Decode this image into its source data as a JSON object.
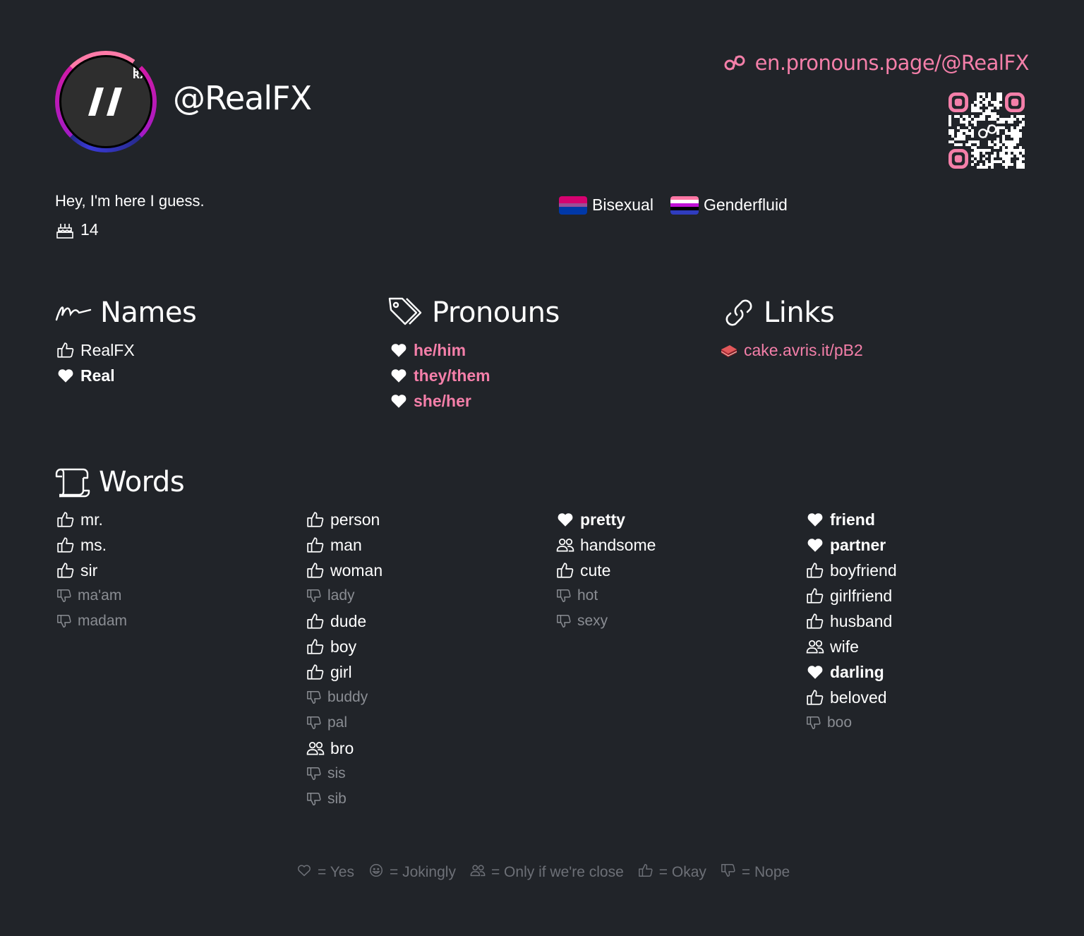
{
  "profile": {
    "avatar_text": [
      "RX",
      "RX-",
      "RX-/"
    ],
    "username": "@RealFX",
    "page_url": "en.pronouns.page/@RealFX",
    "bio": "Hey, I'm here I guess.",
    "age": "14"
  },
  "flags": [
    {
      "label": "Bisexual",
      "colors": [
        "#d60270",
        "#d60270",
        "#9b4f96",
        "#0038a8",
        "#0038a8"
      ]
    },
    {
      "label": "Genderfluid",
      "colors": [
        "#ff76a4",
        "#ffffff",
        "#c011d7",
        "#000000",
        "#2f3cbe"
      ]
    }
  ],
  "sections": {
    "names": {
      "title": "Names",
      "items": [
        {
          "label": "RealFX",
          "opinion": "okay"
        },
        {
          "label": "Real",
          "opinion": "yes"
        }
      ]
    },
    "pronouns": {
      "title": "Pronouns",
      "items": [
        {
          "label": "he/him",
          "opinion": "yes"
        },
        {
          "label": "they/them",
          "opinion": "yes"
        },
        {
          "label": "she/her",
          "opinion": "yes"
        }
      ]
    },
    "links": {
      "title": "Links",
      "items": [
        {
          "label": "cake.avris.it/pB2"
        }
      ]
    },
    "words": {
      "title": "Words",
      "columns": [
        [
          {
            "label": "mr.",
            "opinion": "okay"
          },
          {
            "label": "ms.",
            "opinion": "okay"
          },
          {
            "label": "sir",
            "opinion": "okay"
          },
          {
            "label": "ma'am",
            "opinion": "nope"
          },
          {
            "label": "madam",
            "opinion": "nope"
          }
        ],
        [
          {
            "label": "person",
            "opinion": "okay"
          },
          {
            "label": "man",
            "opinion": "okay"
          },
          {
            "label": "woman",
            "opinion": "okay"
          },
          {
            "label": "lady",
            "opinion": "nope"
          },
          {
            "label": "dude",
            "opinion": "okay"
          },
          {
            "label": "boy",
            "opinion": "okay"
          },
          {
            "label": "girl",
            "opinion": "okay"
          },
          {
            "label": "buddy",
            "opinion": "nope"
          },
          {
            "label": "pal",
            "opinion": "nope"
          },
          {
            "label": "bro",
            "opinion": "close"
          },
          {
            "label": "sis",
            "opinion": "nope"
          },
          {
            "label": "sib",
            "opinion": "nope"
          }
        ],
        [
          {
            "label": "pretty",
            "opinion": "yes"
          },
          {
            "label": "handsome",
            "opinion": "close"
          },
          {
            "label": "cute",
            "opinion": "okay"
          },
          {
            "label": "hot",
            "opinion": "nope"
          },
          {
            "label": "sexy",
            "opinion": "nope"
          }
        ],
        [
          {
            "label": "friend",
            "opinion": "yes"
          },
          {
            "label": "partner",
            "opinion": "yes"
          },
          {
            "label": "boyfriend",
            "opinion": "okay"
          },
          {
            "label": "girlfriend",
            "opinion": "okay"
          },
          {
            "label": "husband",
            "opinion": "okay"
          },
          {
            "label": "wife",
            "opinion": "close"
          },
          {
            "label": "darling",
            "opinion": "yes"
          },
          {
            "label": "beloved",
            "opinion": "okay"
          },
          {
            "label": "boo",
            "opinion": "nope"
          }
        ]
      ]
    }
  },
  "legend": [
    {
      "icon": "heart-icon",
      "label": "= Yes"
    },
    {
      "icon": "smile-icon",
      "label": "= Jokingly"
    },
    {
      "icon": "people-icon",
      "label": "= Only if we're close"
    },
    {
      "icon": "thumbs-up-icon",
      "label": "= Okay"
    },
    {
      "icon": "thumbs-down-icon",
      "label": "= Nope"
    }
  ],
  "colors": {
    "background": "#212429",
    "accent": "#f47fa9",
    "muted": "#8a8d93"
  }
}
